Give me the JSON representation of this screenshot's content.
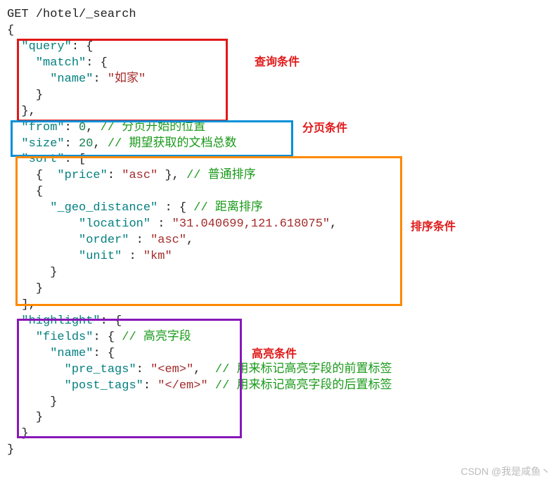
{
  "request": {
    "method": "GET",
    "path": "/hotel/_search"
  },
  "q": {
    "query_key": "\"query\"",
    "match_key": "\"match\"",
    "name_key": "\"name\"",
    "name_val": "\"如家\""
  },
  "pg": {
    "from_key": "\"from\"",
    "from_val": "0",
    "from_comment": "// 分页开始的位置",
    "size_key": "\"size\"",
    "size_val": "20",
    "size_comment": "// 期望获取的文档总数"
  },
  "srt": {
    "sort_key": "\"sort\"",
    "price_key": "\"price\"",
    "price_val": "\"asc\"",
    "price_comment": "// 普通排序",
    "geo_key": "\"_geo_distance\"",
    "geo_comment": "// 距离排序",
    "location_key": "\"location\"",
    "location_val": "\"31.040699,121.618075\"",
    "order_key": "\"order\"",
    "order_val": "\"asc\"",
    "unit_key": "\"unit\"",
    "unit_val": "\"km\""
  },
  "hl": {
    "highlight_key": "\"highlight\"",
    "fields_key": "\"fields\"",
    "fields_comment": "// 高亮字段",
    "name_key": "\"name\"",
    "pre_key": "\"pre_tags\"",
    "pre_val": "\"<em>\"",
    "pre_comment": "// 用来标记高亮字段的前置标签",
    "post_key": "\"post_tags\"",
    "post_val": "\"</em>\"",
    "post_comment": "// 用来标记高亮字段的后置标签"
  },
  "labels": {
    "query": "查询条件",
    "page": "分页条件",
    "sort": "排序条件",
    "highlight": "高亮条件"
  },
  "watermark": "CSDN @我是咸鱼丶"
}
